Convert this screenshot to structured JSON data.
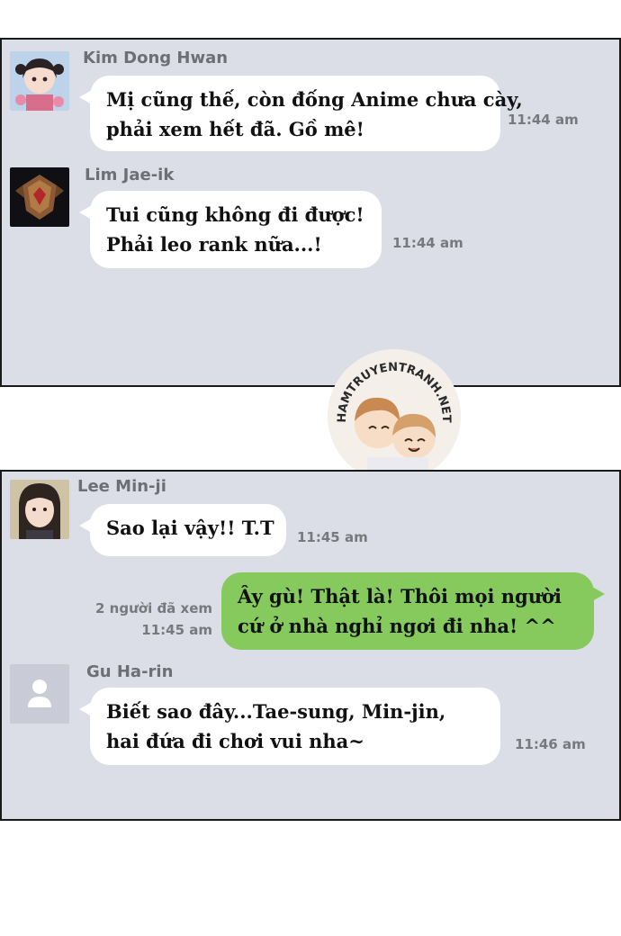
{
  "panel1": {
    "messages": [
      {
        "sender": "Kim Dong Hwan",
        "avatar": "anime-girl-avatar",
        "lines": [
          "Mị cũng thế, còn đống Anime chưa cày,",
          "phải xem hết đã. Gồ mê!"
        ],
        "time": "11:44 am"
      },
      {
        "sender": "Lim Jae-ik",
        "avatar": "rank-emblem-avatar",
        "lines": [
          "Tui cũng không đi được!",
          "Phải leo rank nữa...!"
        ],
        "time": "11:44 am"
      }
    ]
  },
  "watermark": {
    "text": "HAMTRUYENTRANH.NET",
    "image": "two-smiling-people-logo"
  },
  "panel2": {
    "msg1": {
      "sender": "Lee Min-ji",
      "avatar": "girl-photo-avatar",
      "lines": [
        "Sao lại vậy!! T.T"
      ],
      "time": "11:45 am"
    },
    "msg2": {
      "read_receipt": "2 người đã xem",
      "time": "11:45 am",
      "lines": [
        "Ây gù! Thật là! Thôi mọi người",
        "cứ ở nhà nghỉ ngơi đi nha! ^^"
      ]
    },
    "msg3": {
      "sender": "Gu Ha-rin",
      "avatar": "default-user-avatar",
      "lines": [
        "Biết sao đây...Tae-sung, Min-jin,",
        "hai đứa đi chơi vui nha~"
      ],
      "time": "11:46 am"
    }
  },
  "colors": {
    "panel_bg": "#dcdee7",
    "bubble_white": "#ffffff",
    "bubble_green": "#86c95d",
    "meta_text": "#77797f"
  }
}
